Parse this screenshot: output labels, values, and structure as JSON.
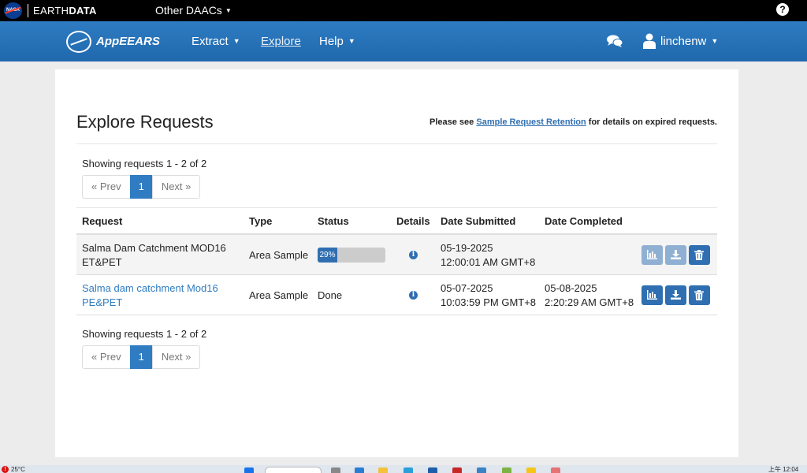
{
  "topbar": {
    "nasa_logo": "NASA",
    "brand_light": "EARTH",
    "brand_bold": "DATA",
    "other_daacs": "Other DAACs",
    "help_icon": "?"
  },
  "navbar": {
    "app_name": "AppEEARS",
    "extract": "Extract",
    "explore": "Explore",
    "help": "Help",
    "user": "linchenw"
  },
  "page": {
    "title": "Explore Requests",
    "retention_prefix": "Please see",
    "retention_link": "Sample Request Retention",
    "retention_suffix": "for details on expired requests.",
    "showing": "Showing requests 1 - 2 of 2",
    "pager": {
      "prev": "« Prev",
      "current": "1",
      "next": "Next »"
    }
  },
  "table": {
    "headers": {
      "request": "Request",
      "type": "Type",
      "status": "Status",
      "details": "Details",
      "date_submitted": "Date Submitted",
      "date_completed": "Date Completed"
    },
    "rows": [
      {
        "name_line1": "Salma Dam Catchment MOD16",
        "name_line2": "ET&PET",
        "type": "Area Sample",
        "progress_label": "29%",
        "progress_percent": 29,
        "submitted_date": "05-19-2025",
        "submitted_time": "12:00:01 AM GMT+8",
        "completed_date": "",
        "completed_time": ""
      },
      {
        "name_line1": "Salma dam catchment Mod16",
        "name_line2": "PE&PET",
        "type": "Area Sample",
        "status": "Done",
        "submitted_date": "05-07-2025",
        "submitted_time": "10:03:59 PM GMT+8",
        "completed_date": "05-08-2025",
        "completed_time": "2:20:29 AM GMT+8"
      }
    ]
  },
  "taskbar": {
    "weather_temp": "25°C",
    "clock": "上午 12:04"
  },
  "colors": {
    "nav_blue": "#2f7cc2",
    "button_blue": "#2f6fb1",
    "button_disabled": "#8fb0d2"
  }
}
